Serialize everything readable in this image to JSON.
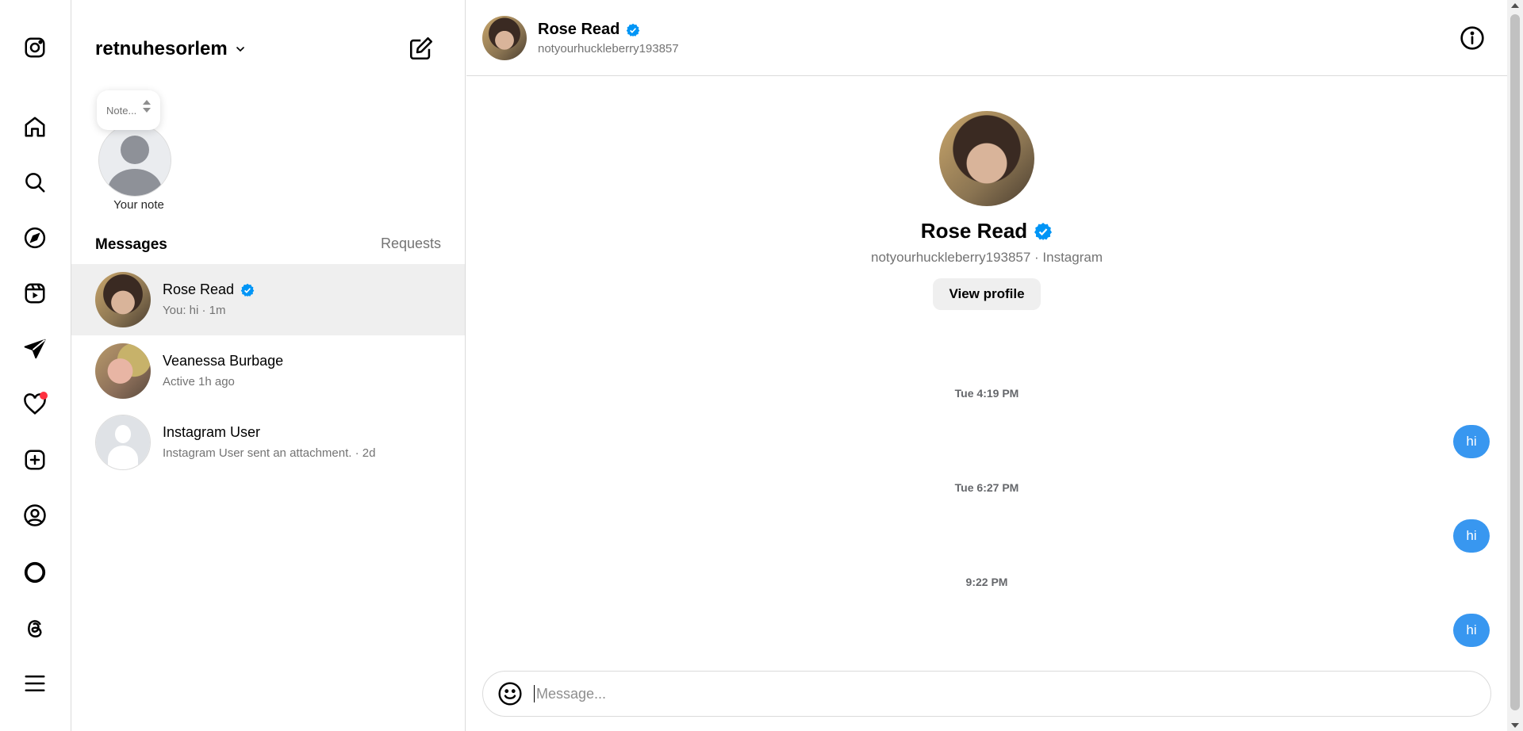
{
  "colors": {
    "accent_blue": "#3897f0",
    "verified_blue": "#0095f6",
    "notification_red": "#ff3040",
    "active_row": "#efefef"
  },
  "rail": {
    "icons": [
      "instagram-logo-icon",
      "home-icon",
      "search-icon",
      "explore-icon",
      "reels-icon",
      "direct-send-icon",
      "heart-icon",
      "create-icon",
      "profile-icon",
      "meta-ai-icon",
      "threads-icon",
      "menu-icon"
    ]
  },
  "account": {
    "username": "retnuhesorlem"
  },
  "note": {
    "bubble_text": "Note...",
    "label": "Your note"
  },
  "list": {
    "messages_heading": "Messages",
    "requests_label": "Requests",
    "conversations": [
      {
        "name": "Rose Read",
        "verified": true,
        "preview": "You: hi · 1m",
        "active": true
      },
      {
        "name": "Veanessa Burbage",
        "verified": false,
        "preview": "Active 1h ago",
        "active": false
      },
      {
        "name": "Instagram User",
        "verified": false,
        "preview": "Instagram User sent an attachment. · 2d",
        "active": false
      }
    ]
  },
  "chat": {
    "header_name": "Rose Read",
    "header_handle": "notyourhuckleberry193857",
    "profile_name": "Rose Read",
    "profile_subline": "notyourhuckleberry193857 · Instagram",
    "view_profile_label": "View profile",
    "thread": [
      {
        "timestamp": "Tue 4:19 PM",
        "message": "hi"
      },
      {
        "timestamp": "Tue 6:27 PM",
        "message": "hi"
      },
      {
        "timestamp": "9:22 PM",
        "message": "hi"
      }
    ],
    "composer_placeholder": "Message..."
  }
}
